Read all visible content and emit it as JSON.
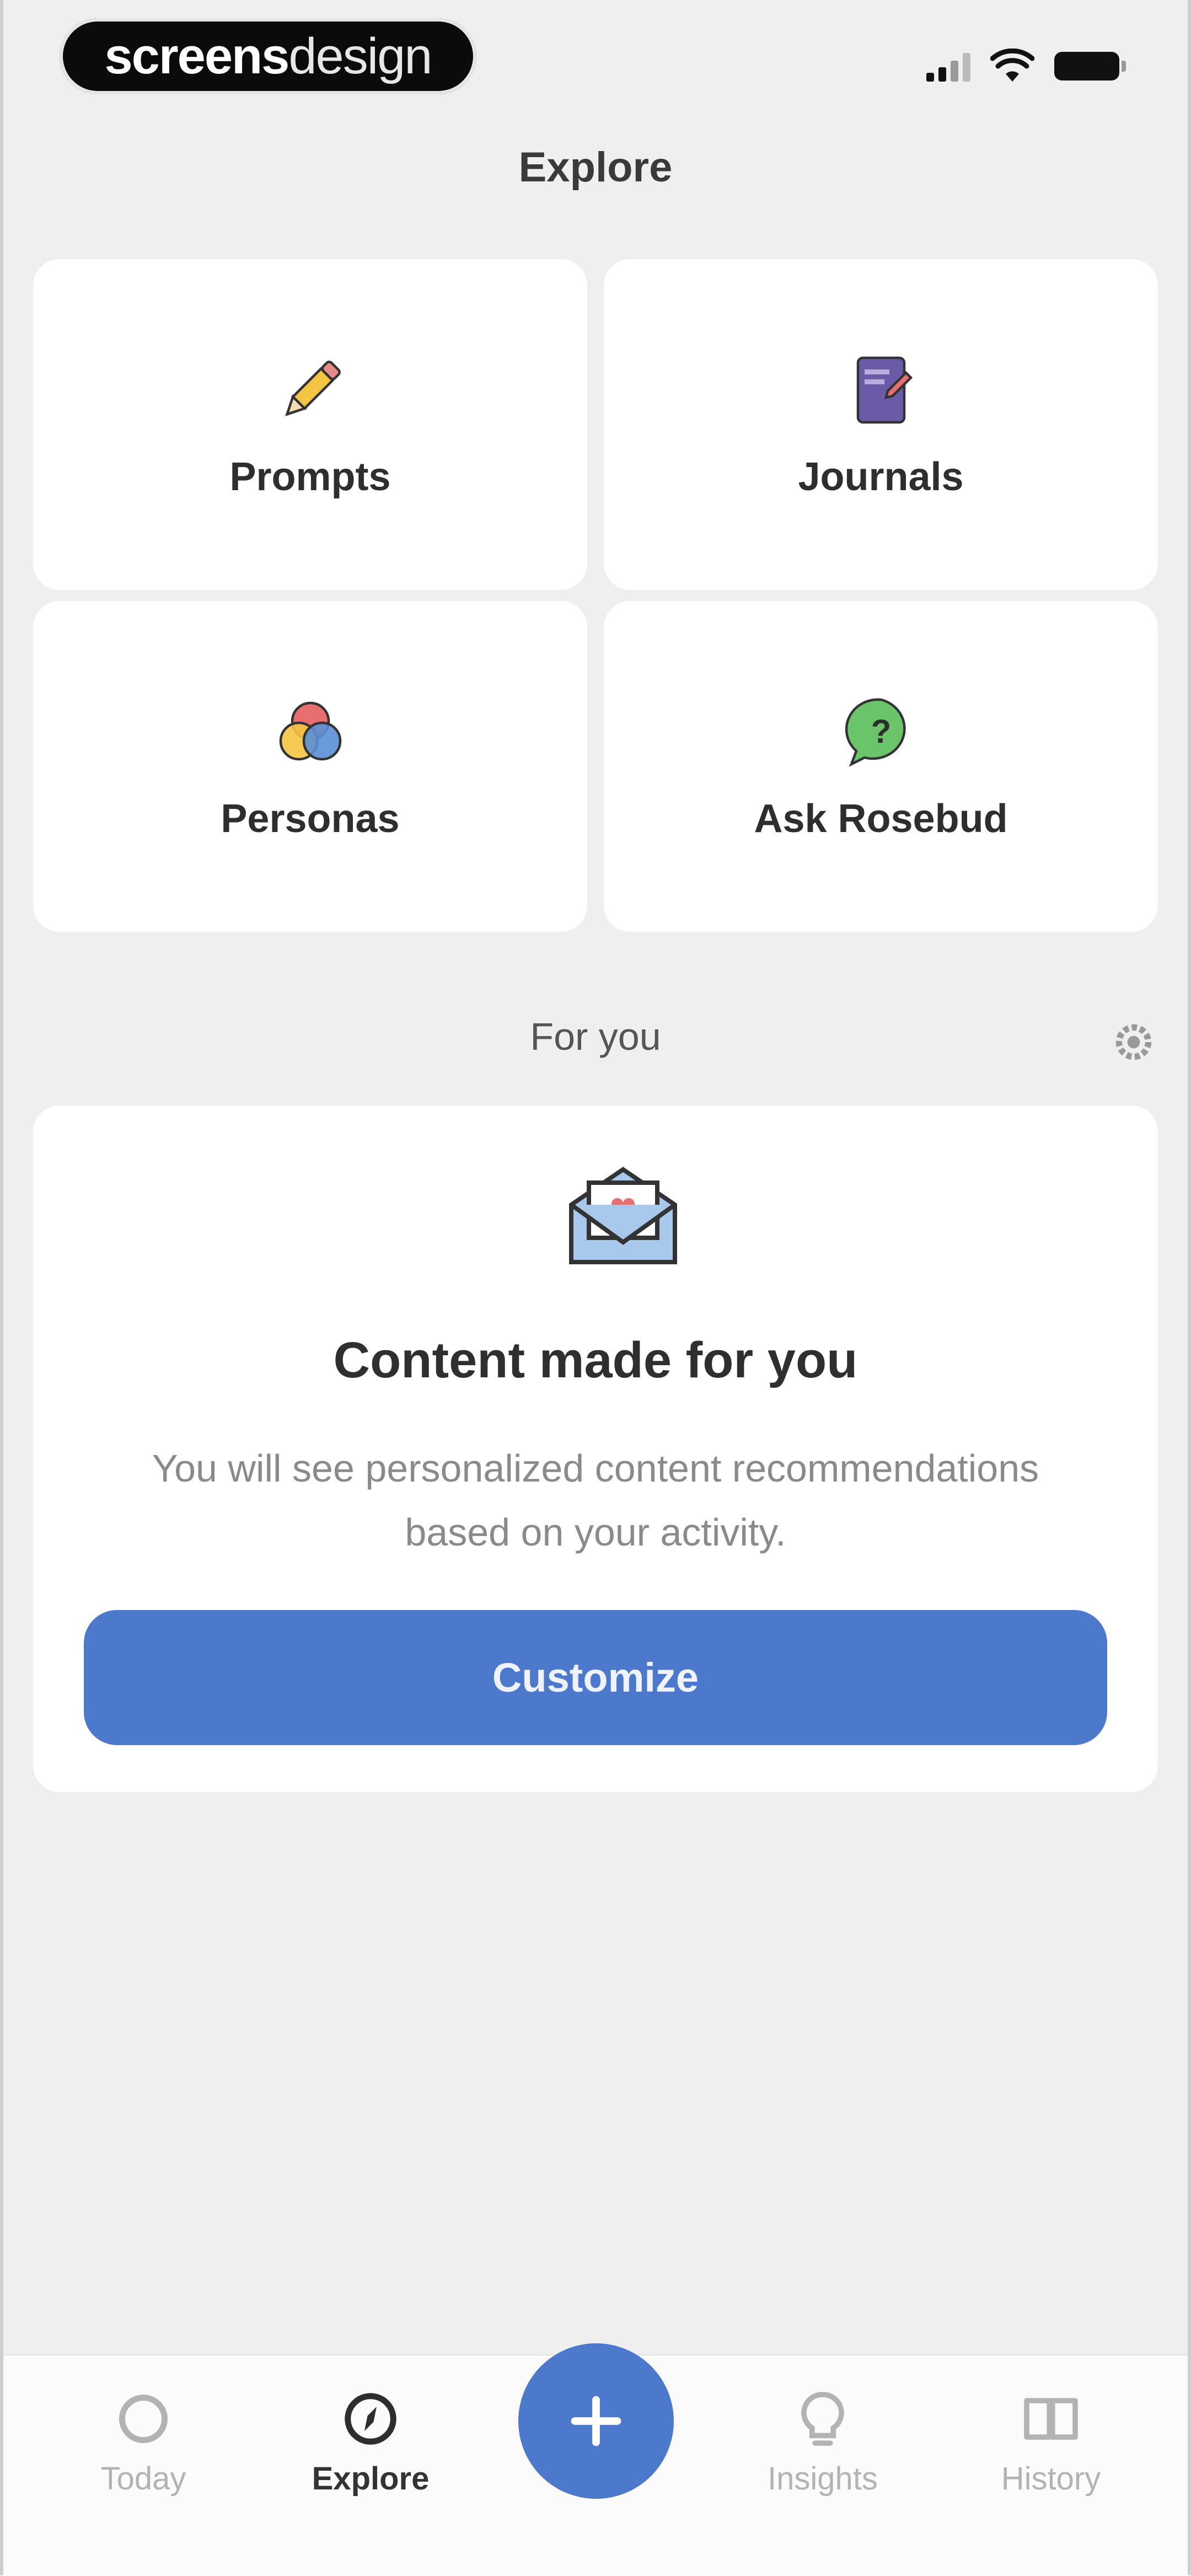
{
  "status_bar": {
    "brand_bold": "screens",
    "brand_thin": "design"
  },
  "header": {
    "title": "Explore"
  },
  "tiles": [
    {
      "label": "Prompts",
      "icon": "pencil-icon"
    },
    {
      "label": "Journals",
      "icon": "journal-icon"
    },
    {
      "label": "Personas",
      "icon": "personas-icon"
    },
    {
      "label": "Ask Rosebud",
      "icon": "chat-question-icon"
    }
  ],
  "for_you": {
    "section_title": "For you",
    "headline": "Content made for you",
    "description": "You will see personalized content recommendations based on your activity.",
    "button_label": "Customize"
  },
  "tabbar": {
    "items": [
      {
        "label": "Today",
        "icon": "circle-icon",
        "active": false
      },
      {
        "label": "Explore",
        "icon": "compass-icon",
        "active": true
      },
      {
        "label": "Insights",
        "icon": "lightbulb-icon",
        "active": false
      },
      {
        "label": "History",
        "icon": "book-icon",
        "active": false
      }
    ],
    "fab_icon": "plus-icon"
  },
  "colors": {
    "accent": "#4d79cc",
    "background": "#efefef",
    "card": "#ffffff"
  }
}
